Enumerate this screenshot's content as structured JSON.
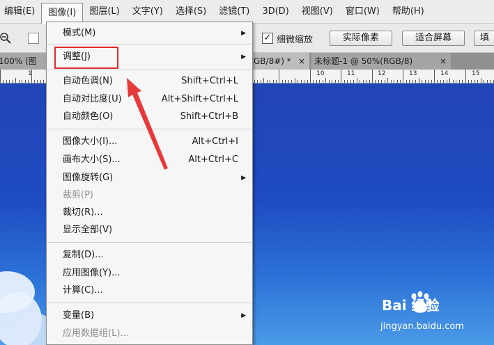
{
  "menubar": {
    "items": [
      "编辑(E)",
      "图像(I)",
      "图层(L)",
      "文字(Y)",
      "选择(S)",
      "滤镜(T)",
      "3D(D)",
      "视图(V)",
      "窗口(W)",
      "帮助(H)"
    ],
    "active": "图像(I)"
  },
  "options": {
    "checkbox_label": "细微缩放",
    "checkbox_checked": true,
    "btn_actual": "实际像素",
    "btn_fit": "适合屏幕",
    "btn_fill": "填"
  },
  "tabs": {
    "tab1": "100% (图",
    "tab2": "GB/8#) *",
    "tab3": "未标题-1 @ 50%(RGB/8)",
    "close": "×"
  },
  "ruler": {
    "labels": [
      "1",
      "10",
      "11",
      "12",
      "13",
      "14",
      "15"
    ]
  },
  "menu": {
    "items": [
      {
        "label": "模式(M)",
        "shortcut": "",
        "submenu": true,
        "disabled": false
      },
      {
        "label": "调整(J)",
        "shortcut": "",
        "submenu": true,
        "disabled": false
      },
      {
        "label": "自动色调(N)",
        "shortcut": "Shift+Ctrl+L",
        "submenu": false,
        "disabled": false
      },
      {
        "label": "自动对比度(U)",
        "shortcut": "Alt+Shift+Ctrl+L",
        "submenu": false,
        "disabled": false
      },
      {
        "label": "自动颜色(O)",
        "shortcut": "Shift+Ctrl+B",
        "submenu": false,
        "disabled": false
      },
      {
        "label": "图像大小(I)...",
        "shortcut": "Alt+Ctrl+I",
        "submenu": false,
        "disabled": false
      },
      {
        "label": "画布大小(S)...",
        "shortcut": "Alt+Ctrl+C",
        "submenu": false,
        "disabled": false
      },
      {
        "label": "图像旋转(G)",
        "shortcut": "",
        "submenu": true,
        "disabled": false
      },
      {
        "label": "裁剪(P)",
        "shortcut": "",
        "submenu": false,
        "disabled": true
      },
      {
        "label": "裁切(R)...",
        "shortcut": "",
        "submenu": false,
        "disabled": false
      },
      {
        "label": "显示全部(V)",
        "shortcut": "",
        "submenu": false,
        "disabled": false
      },
      {
        "label": "复制(D)...",
        "shortcut": "",
        "submenu": false,
        "disabled": false
      },
      {
        "label": "应用图像(Y)...",
        "shortcut": "",
        "submenu": false,
        "disabled": false
      },
      {
        "label": "计算(C)...",
        "shortcut": "",
        "submenu": false,
        "disabled": false
      },
      {
        "label": "变量(B)",
        "shortcut": "",
        "submenu": true,
        "disabled": false
      },
      {
        "label": "应用数据组(L)...",
        "shortcut": "",
        "submenu": false,
        "disabled": true
      }
    ],
    "submenu_glyph": "▶",
    "highlighted": "调整(J)"
  },
  "watermark": {
    "brand": "Bai  经验",
    "url": "jingyan.baidu.com"
  },
  "colors": {
    "highlight_box": "#e02b2b",
    "annotation_arrow": "#e8393a",
    "canvas_blue": "#1f4cc2"
  }
}
